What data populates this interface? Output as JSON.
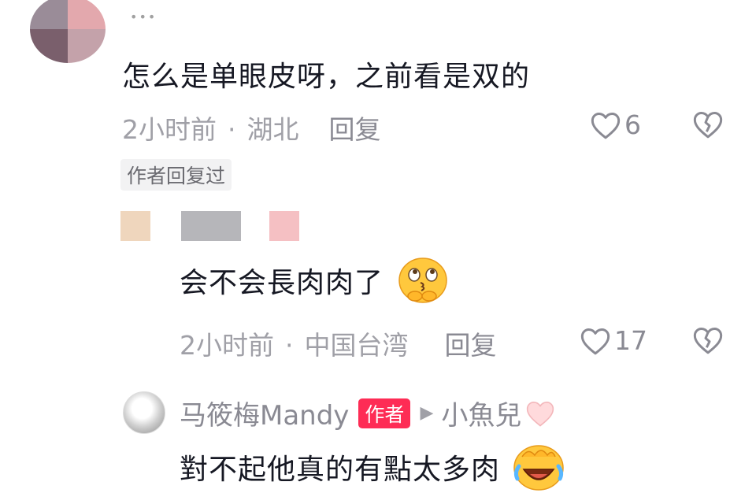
{
  "comment1": {
    "username": "•••",
    "text": "怎么是单眼皮呀，之前看是双的",
    "time": "2小时前",
    "location": "湖北",
    "reply_label": "回复",
    "like_count": "6",
    "author_replied_tag": "作者回复过"
  },
  "comment2": {
    "text": "会不会長肉肉了",
    "emoji_icon": "thinking-kiss-emoji",
    "time": "2小时前",
    "location": "中国台湾",
    "reply_label": "回复",
    "like_count": "17"
  },
  "comment3": {
    "username": "马筱梅Mandy",
    "author_badge": "作者",
    "reply_to": "小魚兒",
    "text": "對不起他真的有點太多肉",
    "emoji_icon": "laughing-crying-emoji"
  },
  "colors": {
    "accent": "#fe2c55",
    "meta_gray": "#a0a0a7",
    "text_dark": "#161823"
  }
}
